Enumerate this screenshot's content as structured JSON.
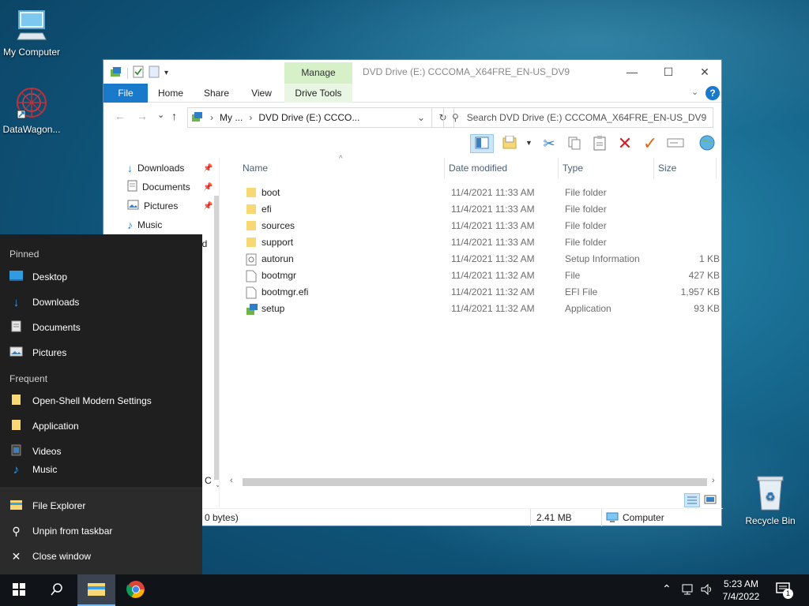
{
  "desktop": {
    "icons": [
      {
        "label": "My Computer",
        "icon": "computer-icon"
      },
      {
        "label": "DataWagon...",
        "icon": "datawagon-icon"
      },
      {
        "label": "Recycle Bin",
        "icon": "recycle-bin-icon"
      }
    ]
  },
  "window": {
    "title": "DVD Drive (E:) CCCOMA_X64FRE_EN-US_DV9",
    "manage_tab": "Manage",
    "ribbon_tabs": [
      "File",
      "Home",
      "Share",
      "View",
      "Drive Tools"
    ],
    "address": {
      "crumb1": "My ...",
      "crumb2": "DVD Drive (E:) CCCO..."
    },
    "search_placeholder": "Search DVD Drive (E:) CCCOMA_X64FRE_EN-US_DV9",
    "nav_items": [
      {
        "label": "Downloads",
        "icon": "download-arrow-icon",
        "pinned": true
      },
      {
        "label": "Documents",
        "icon": "documents-icon",
        "pinned": true
      },
      {
        "label": "Pictures",
        "icon": "pictures-icon",
        "pinned": true
      },
      {
        "label": "Music",
        "icon": "music-icon",
        "pinned": false
      }
    ],
    "nav_partial_text": "od",
    "nav_partial_bottom": "C",
    "columns": {
      "name": "Name",
      "date": "Date modified",
      "type": "Type",
      "size": "Size"
    },
    "files": [
      {
        "name": "boot",
        "date": "11/4/2021 11:33 AM",
        "type": "File folder",
        "size": "",
        "icon": "folder-icon"
      },
      {
        "name": "efi",
        "date": "11/4/2021 11:33 AM",
        "type": "File folder",
        "size": "",
        "icon": "folder-icon"
      },
      {
        "name": "sources",
        "date": "11/4/2021 11:33 AM",
        "type": "File folder",
        "size": "",
        "icon": "folder-icon"
      },
      {
        "name": "support",
        "date": "11/4/2021 11:33 AM",
        "type": "File folder",
        "size": "",
        "icon": "folder-icon"
      },
      {
        "name": "autorun",
        "date": "11/4/2021 11:32 AM",
        "type": "Setup Information",
        "size": "1 KB",
        "icon": "setup-info-icon"
      },
      {
        "name": "bootmgr",
        "date": "11/4/2021 11:32 AM",
        "type": "File",
        "size": "427 KB",
        "icon": "file-icon"
      },
      {
        "name": "bootmgr.efi",
        "date": "11/4/2021 11:32 AM",
        "type": "EFI File",
        "size": "1,957 KB",
        "icon": "file-icon"
      },
      {
        "name": "setup",
        "date": "11/4/2021 11:32 AM",
        "type": "Application",
        "size": "93 KB",
        "icon": "setup-app-icon"
      }
    ],
    "status": {
      "selection": "0 bytes)",
      "size": "2.41 MB",
      "location": "Computer"
    }
  },
  "jumplist": {
    "pinned_header": "Pinned",
    "pinned": [
      {
        "label": "Desktop",
        "icon": "desktop-icon"
      },
      {
        "label": "Downloads",
        "icon": "download-arrow-icon"
      },
      {
        "label": "Documents",
        "icon": "documents-icon"
      },
      {
        "label": "Pictures",
        "icon": "pictures-icon"
      }
    ],
    "frequent_header": "Frequent",
    "frequent": [
      {
        "label": "Open-Shell Modern Settings",
        "icon": "folder-icon"
      },
      {
        "label": "Application",
        "icon": "folder-icon"
      },
      {
        "label": "Videos",
        "icon": "videos-icon"
      },
      {
        "label": "Music",
        "icon": "music-icon"
      }
    ],
    "actions": [
      {
        "label": "File Explorer",
        "icon": "file-explorer-icon"
      },
      {
        "label": "Unpin from taskbar",
        "icon": "unpin-icon"
      },
      {
        "label": "Close window",
        "icon": "close-icon"
      }
    ]
  },
  "taskbar": {
    "time": "5:23 AM",
    "date": "7/4/2022",
    "notification_count": "1"
  },
  "colors": {
    "accent": "#1979ca",
    "manage_tab": "#d6f0c8",
    "folder": "#f8d775",
    "jumplist_bg": "#1f1f1f",
    "taskbar_bg": "#101418"
  }
}
